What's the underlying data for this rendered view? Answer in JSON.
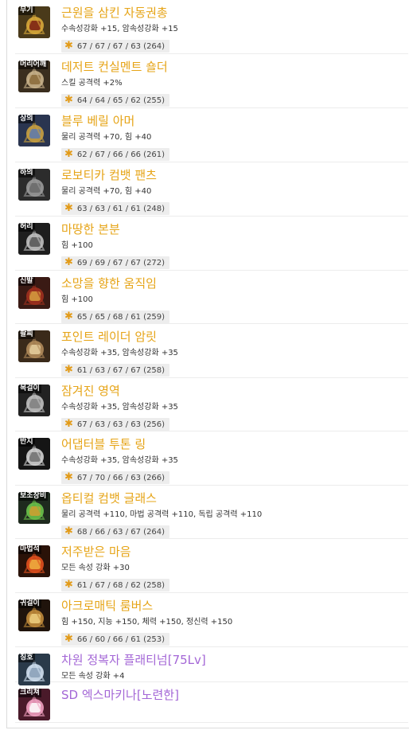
{
  "colors": {
    "unique_name": "#e6a417",
    "legendary_name": "#a366d6",
    "star": "#e29b19"
  },
  "items": [
    {
      "slot": "무기",
      "icon": "weapon-icon",
      "name": "근원을 삼킨 자동권총",
      "options": "수속성강화 +15, 암속성강화 +15",
      "stats": "67 / 67 / 67 / 63 (264)"
    },
    {
      "slot": "머리어깨",
      "icon": "shoulder-icon",
      "name": "데저트 컨실멘트 숄더",
      "options": "스킬 공격력 +2%",
      "stats": "64 / 64 / 65 / 62 (255)"
    },
    {
      "slot": "상의",
      "icon": "top-armor-icon",
      "name": "블루 베릴 아머",
      "options": "물리 공격력 +70, 힘 +40",
      "stats": "62 / 67 / 66 / 66 (261)"
    },
    {
      "slot": "하의",
      "icon": "pants-icon",
      "name": "로보티카 컴뱃 팬츠",
      "options": "물리 공격력 +70, 힘 +40",
      "stats": "63 / 63 / 61 / 61 (248)"
    },
    {
      "slot": "허리",
      "icon": "belt-icon",
      "name": "마땅한 본분",
      "options": "힘 +100",
      "stats": "69 / 69 / 67 / 67 (272)"
    },
    {
      "slot": "신발",
      "icon": "shoes-icon",
      "name": "소망을 향한 움직임",
      "options": "힘 +100",
      "stats": "65 / 65 / 68 / 61 (259)"
    },
    {
      "slot": "팔찌",
      "icon": "bracelet-icon",
      "name": "포인트 레이더 암릿",
      "options": "수속성강화 +35, 암속성강화 +35",
      "stats": "61 / 63 / 67 / 67 (258)"
    },
    {
      "slot": "목걸이",
      "icon": "necklace-icon",
      "name": "잠겨진 영역",
      "options": "수속성강화 +35, 암속성강화 +35",
      "stats": "67 / 63 / 63 / 63 (256)"
    },
    {
      "slot": "반지",
      "icon": "ring-icon",
      "name": "어댑터블 투톤 링",
      "options": "수속성강화 +35, 암속성강화 +35",
      "stats": "67 / 70 / 66 / 63 (266)"
    },
    {
      "slot": "보조장비",
      "icon": "sub-equipment-icon",
      "name": "옵티컬 컴뱃 글래스",
      "options": "물리 공격력 +110, 마법 공격력 +110, 독립 공격력 +110",
      "stats": "68 / 66 / 63 / 67 (264)"
    },
    {
      "slot": "마법석",
      "icon": "magic-stone-icon",
      "name": "저주받은 마음",
      "options": "모든 속성 강화 +30",
      "stats": "61 / 67 / 68 / 62 (258)"
    },
    {
      "slot": "귀걸이",
      "icon": "earring-icon",
      "name": "아크로매틱 룸버스",
      "options": "힘 +150, 지능 +150, 체력 +150, 정신력 +150",
      "stats": "66 / 60 / 66 / 61 (253)"
    },
    {
      "slot": "칭호",
      "icon": "title-icon",
      "name": "차원 정복자 플래티넘[75Lv]",
      "options": "모든 속성 강화 +4"
    },
    {
      "slot": "크리쳐",
      "icon": "creature-icon",
      "name": "SD 엑스마키나[노련한]"
    }
  ]
}
